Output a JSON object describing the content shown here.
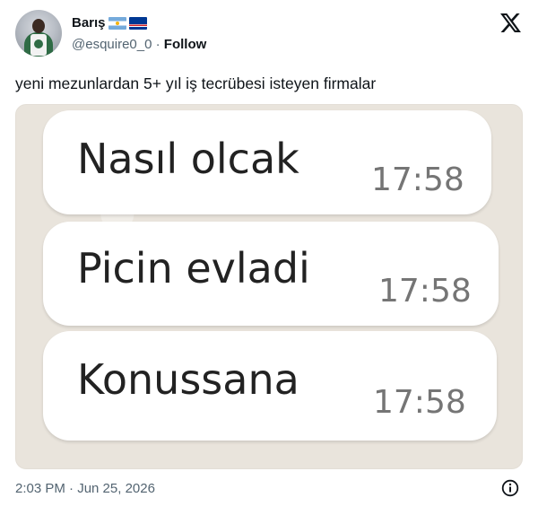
{
  "author": {
    "name": "Barış",
    "flags": [
      "argentina-flag",
      "cape-verde-flag"
    ],
    "handle": "@esquire0_0",
    "separator": "·",
    "follow_label": "Follow"
  },
  "tweet": {
    "text": "yeni mezunlardan 5+ yıl iş tecrübesi isteyen firmalar",
    "timestamp": "2:03 PM · Jun 25, 2026"
  },
  "media": {
    "messages": [
      {
        "text": "Nasıl olcak",
        "time": "17:58"
      },
      {
        "text": "Picin evladi",
        "time": "17:58"
      },
      {
        "text": "Konussana",
        "time": "17:58"
      }
    ]
  },
  "icons": {
    "brand": "x-logo-icon",
    "info": "info-icon"
  },
  "colors": {
    "text": "#0f1419",
    "secondary_text": "#536471",
    "chat_background": "#e9e4dc",
    "bubble": "#ffffff",
    "bubble_time": "#757575"
  }
}
